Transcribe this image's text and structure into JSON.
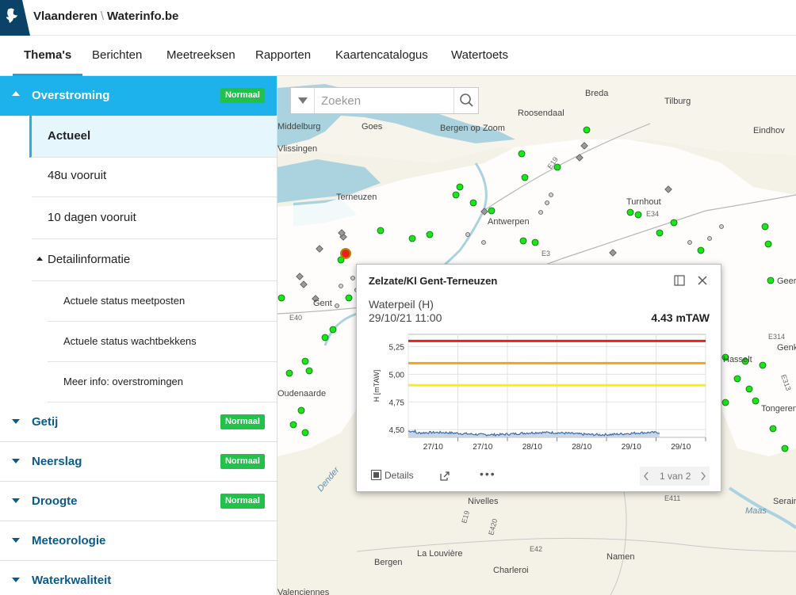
{
  "header": {
    "brand_left": "Vlaanderen",
    "brand_right": "Waterinfo.be"
  },
  "nav": {
    "tabs": [
      "Thema's",
      "Berichten",
      "Meetreeksen",
      "Rapporten",
      "Kaartencatalogus",
      "Watertoets"
    ],
    "active": "Thema's"
  },
  "sidebar": {
    "open_section": {
      "label": "Overstroming",
      "badge": "Normaal",
      "items": [
        "Actueel",
        "48u vooruit",
        "10 dagen vooruit"
      ],
      "active_item": "Actueel",
      "detail": {
        "label": "Detailinformatie",
        "items": [
          "Actuele status meetposten",
          "Actuele status wachtbekkens",
          "Meer info: overstromingen"
        ]
      }
    },
    "sections": [
      {
        "label": "Getij",
        "badge": "Normaal"
      },
      {
        "label": "Neerslag",
        "badge": "Normaal"
      },
      {
        "label": "Droogte",
        "badge": "Normaal"
      },
      {
        "label": "Meteorologie",
        "badge": ""
      },
      {
        "label": "Waterkwaliteit",
        "badge": ""
      }
    ]
  },
  "search": {
    "placeholder": "Zoeken"
  },
  "map": {
    "place_labels": [
      "Breda",
      "Tilburg",
      "Roosendaal",
      "Middelburg",
      "Goes",
      "Bergen op Zoom",
      "Eindhov",
      "Vlissingen",
      "Terneuzen",
      "Turnhout",
      "Antwerpen",
      "Gent",
      "Oudenaarde",
      "Hasselt",
      "Genk",
      "Nivelles",
      "La Louvière",
      "Bergen",
      "Charleroi",
      "Namen",
      "Maas",
      "Serain",
      "Tongeren",
      "Dender",
      "Valenciennes",
      "Geer"
    ],
    "road_labels": [
      "E19",
      "E34",
      "E3",
      "E40",
      "E314",
      "E313",
      "E42",
      "E411",
      "E19",
      "E420"
    ]
  },
  "popup": {
    "title": "Zelzate/Kl Gent-Terneuzen",
    "parameter": "Waterpeil (H)",
    "datetime": "29/10/21 11:00",
    "value": "4.43 mTAW",
    "details_label": "Details",
    "pager": "1 van 2"
  },
  "chart_data": {
    "type": "line",
    "ylabel": "H [mTAW]",
    "xlabel": "",
    "ylim": [
      4.43,
      5.36
    ],
    "yticks": [
      4.5,
      4.75,
      5.0,
      5.25
    ],
    "ytick_labels": [
      "4,50",
      "4,75",
      "5,00",
      "5,25"
    ],
    "xtick_labels": [
      "27/10",
      "27/10",
      "28/10",
      "28/10",
      "29/10",
      "29/10"
    ],
    "grid": true,
    "thresholds": [
      {
        "value": 5.3,
        "color": "#e8221b"
      },
      {
        "value": 5.1,
        "color": "#f6a21a"
      },
      {
        "value": 4.9,
        "color": "#f5ef1f"
      }
    ],
    "series": [
      {
        "color": "#3a6ea5",
        "fill": "#c7d5e6",
        "value_range": [
          4.45,
          4.49
        ],
        "end_fraction": 0.845
      }
    ]
  },
  "colors": {
    "accent": "#1eb2ec",
    "section_text": "#0c5a88",
    "badge": "#21c14a",
    "station_green": "#19e619"
  }
}
